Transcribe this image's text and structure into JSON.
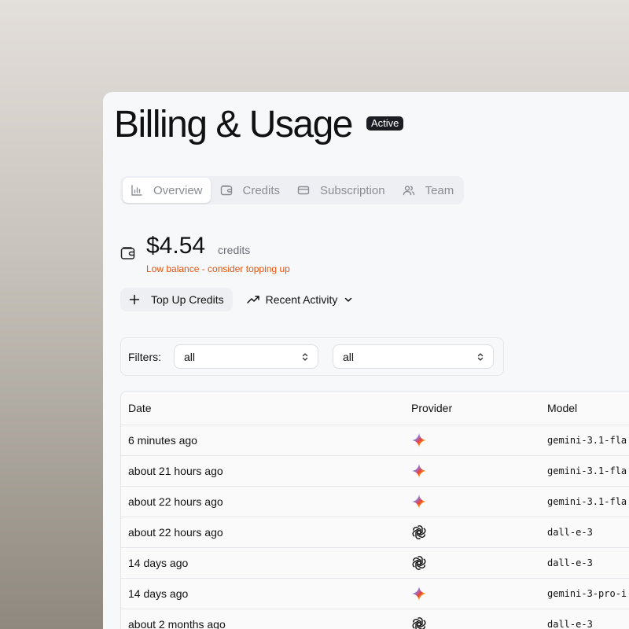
{
  "header": {
    "title": "Billing & Usage",
    "badge": "Active"
  },
  "tabs": [
    {
      "label": "Overview",
      "icon": "bar-chart-icon",
      "active": true
    },
    {
      "label": "Credits",
      "icon": "wallet-icon",
      "active": false
    },
    {
      "label": "Subscription",
      "icon": "credit-card-icon",
      "active": false
    },
    {
      "label": "Team",
      "icon": "users-icon",
      "active": false
    }
  ],
  "balance": {
    "amount": "$4.54",
    "unit": "credits",
    "warning": "Low balance - consider topping up",
    "warning_color": "#e5530f"
  },
  "actions": {
    "top_up": "Top Up Credits",
    "recent_activity": "Recent Activity"
  },
  "filters": {
    "label": "Filters:",
    "provider_value": "all",
    "model_value": "all"
  },
  "table": {
    "columns": [
      "Date",
      "Provider",
      "Model"
    ],
    "rows": [
      {
        "date": "6 minutes ago",
        "provider": "gemini",
        "model": "gemini-3.1-fla"
      },
      {
        "date": "about 21 hours ago",
        "provider": "gemini",
        "model": "gemini-3.1-fla"
      },
      {
        "date": "about 22 hours ago",
        "provider": "gemini",
        "model": "gemini-3.1-fla"
      },
      {
        "date": "about 22 hours ago",
        "provider": "openai",
        "model": "dall-e-3"
      },
      {
        "date": "14 days ago",
        "provider": "openai",
        "model": "dall-e-3"
      },
      {
        "date": "14 days ago",
        "provider": "gemini",
        "model": "gemini-3-pro-i"
      },
      {
        "date": "about 2 months ago",
        "provider": "openai",
        "model": "dall-e-3"
      }
    ]
  }
}
